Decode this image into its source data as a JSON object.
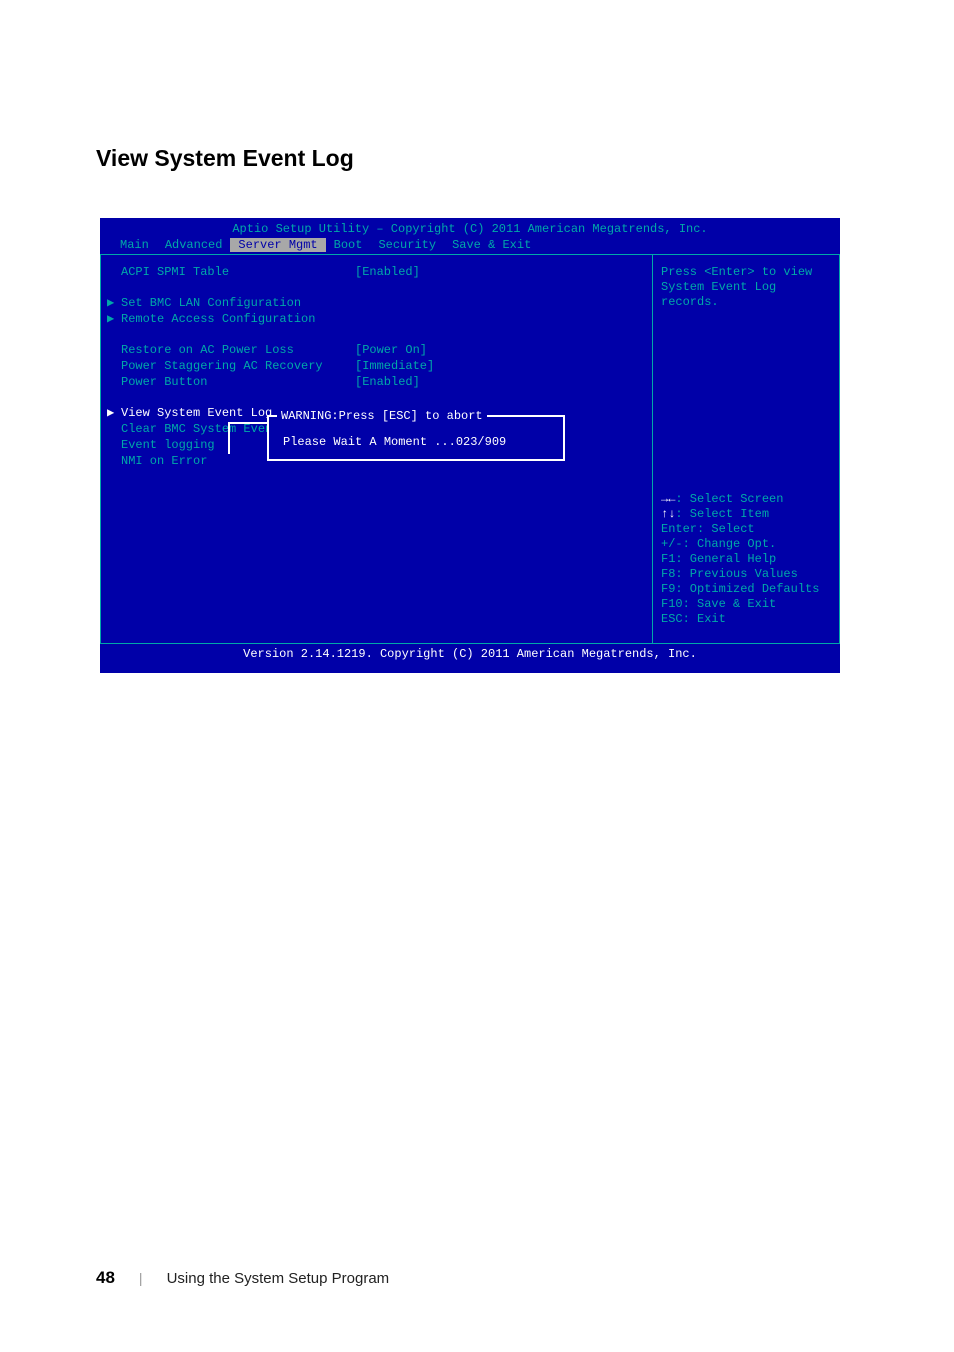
{
  "page": {
    "title": "View System Event Log",
    "number": "48",
    "footer_text": "Using the System Setup Program"
  },
  "bios": {
    "header": "Aptio Setup Utility – Copyright (C) 2011 American Megatrends, Inc.",
    "footer": "Version 2.14.1219. Copyright (C) 2011 American Megatrends, Inc.",
    "menu": {
      "items": [
        "Main",
        "Advanced",
        "Server Mgmt",
        "Boot",
        "Security",
        "Save & Exit"
      ],
      "active_index": 2
    },
    "options": [
      {
        "label": "ACPI SPMI Table",
        "value": "[Enabled]",
        "type": "item"
      },
      {
        "type": "spacer"
      },
      {
        "label": "Set BMC LAN Configuration",
        "value": "",
        "type": "submenu"
      },
      {
        "label": "Remote Access Configuration",
        "value": "",
        "type": "submenu"
      },
      {
        "type": "spacer"
      },
      {
        "label": "Restore on AC Power Loss",
        "value": "[Power On]",
        "type": "item"
      },
      {
        "label": "Power Staggering AC Recovery",
        "value": "[Immediate]",
        "type": "item"
      },
      {
        "label": "Power Button",
        "value": "[Enabled]",
        "type": "item"
      },
      {
        "type": "spacer"
      },
      {
        "label": "View System Event Log",
        "value": "",
        "type": "submenu-selected"
      },
      {
        "label": "Clear BMC System Event Log",
        "value": "",
        "type": "item"
      },
      {
        "label": "Event logging",
        "value": "",
        "type": "item"
      },
      {
        "label": "NMI on Error",
        "value": "",
        "type": "item"
      }
    ],
    "help": {
      "description": "Press <Enter> to view System Event Log records.",
      "keys": [
        {
          "prefix": "→←",
          "text": ": Select Screen"
        },
        {
          "prefix": "↑↓",
          "text": ": Select Item"
        },
        {
          "prefix": "Enter",
          "text": ": Select"
        },
        {
          "prefix": "+/-",
          "text": ": Change Opt."
        },
        {
          "prefix": "F1",
          "text": ": General Help"
        },
        {
          "prefix": "F8",
          "text": ": Previous Values"
        },
        {
          "prefix": "F9",
          "text": ": Optimized Defaults"
        },
        {
          "prefix": "F10",
          "text": ": Save & Exit"
        },
        {
          "prefix": "ESC",
          "text": ": Exit"
        }
      ]
    },
    "popup": {
      "title": "WARNING:Press [ESC] to abort",
      "message": "Please Wait A Moment ...023/909"
    }
  }
}
